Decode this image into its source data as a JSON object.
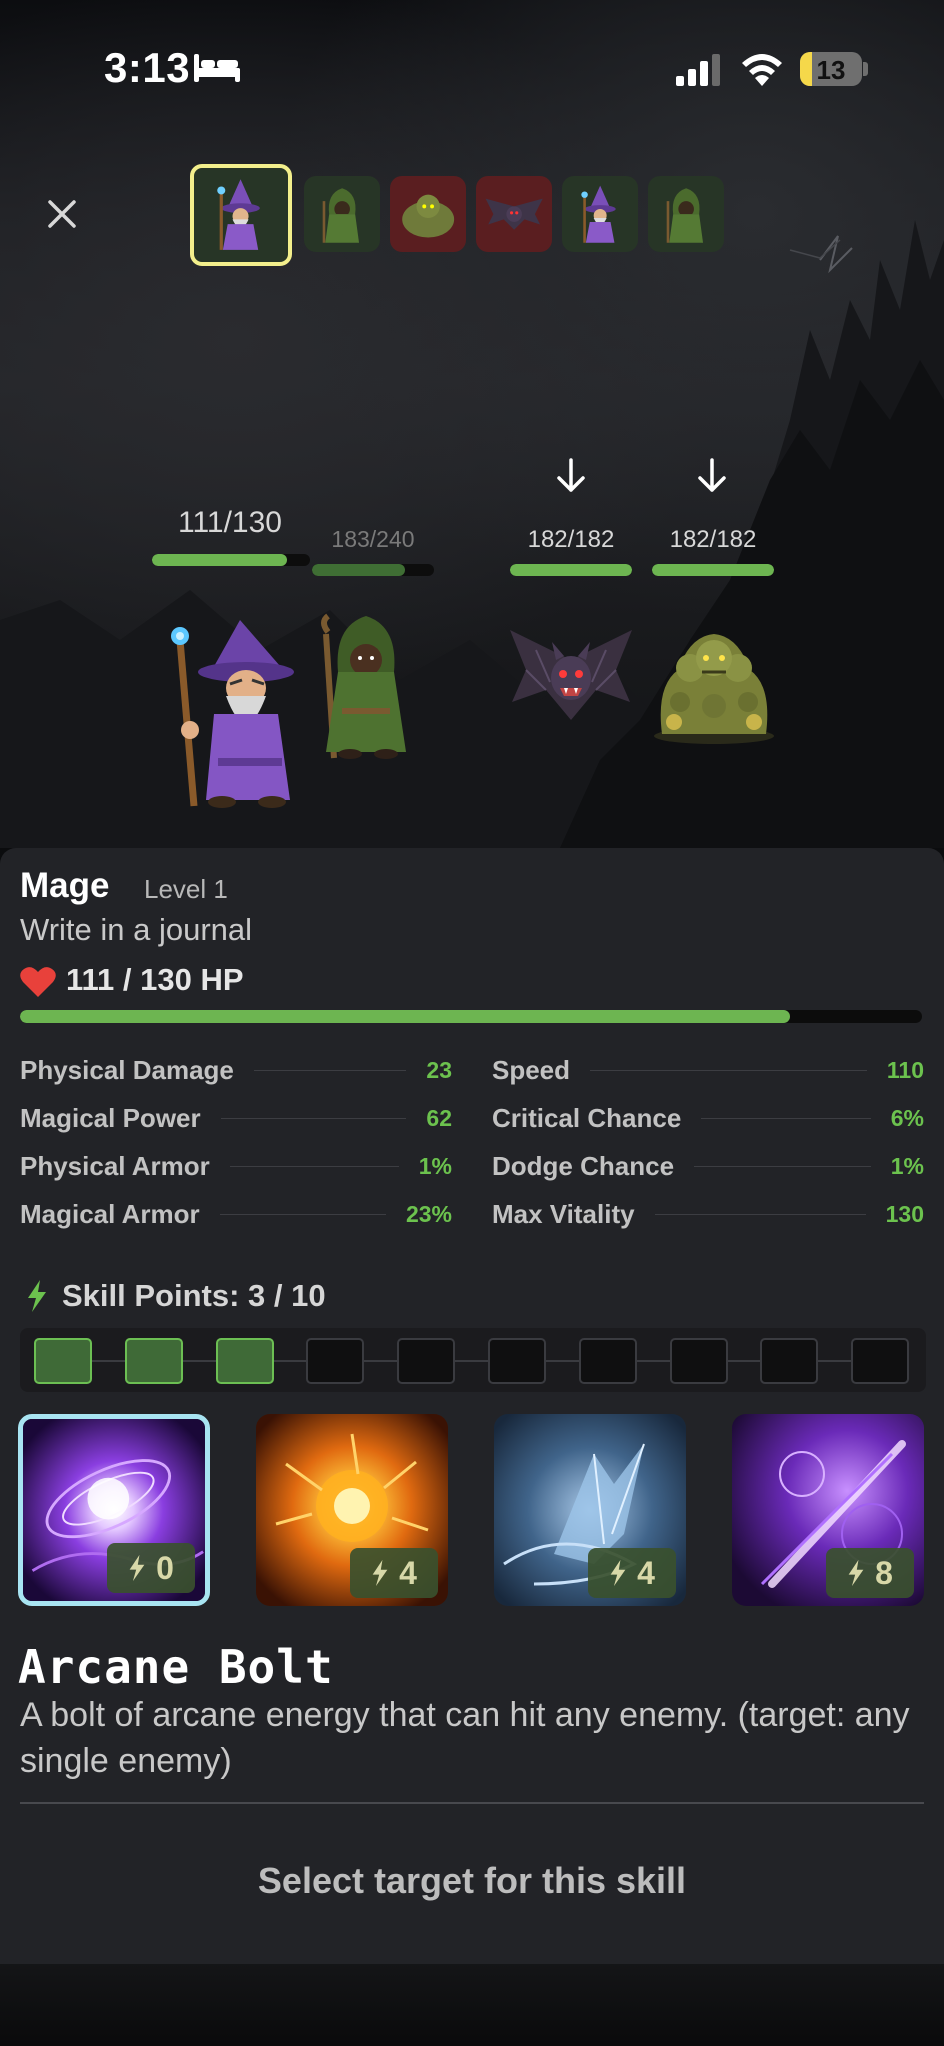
{
  "status_bar": {
    "time": "3:13",
    "battery": "13",
    "icons": [
      "bed-icon",
      "signal-icon",
      "wifi-icon",
      "battery-icon"
    ]
  },
  "turn_order": [
    {
      "unit": "mage",
      "side": "ally",
      "active": true
    },
    {
      "unit": "hooded-rogue",
      "side": "ally",
      "active": false
    },
    {
      "unit": "moss-golem",
      "side": "enemy",
      "active": false
    },
    {
      "unit": "bat",
      "side": "enemy",
      "active": false
    },
    {
      "unit": "mage",
      "side": "ally",
      "active": false
    },
    {
      "unit": "hooded-rogue",
      "side": "ally",
      "active": false
    }
  ],
  "battle": {
    "mage_hp": "111/130",
    "mage_hp_fraction": 0.854,
    "rogue_hp": "183/240",
    "rogue_hp_fraction": 0.7625,
    "bat_hp": "182/182",
    "bat_hp_fraction": 1.0,
    "golem_hp": "182/182",
    "golem_hp_fraction": 1.0
  },
  "character": {
    "name": "Mage",
    "level": "Level 1",
    "task": "Write in a journal",
    "hp_text": "111 / 130 HP",
    "hp_fraction": 0.854
  },
  "stats": {
    "left": [
      {
        "name": "Physical Damage",
        "value": "23"
      },
      {
        "name": "Magical Power",
        "value": "62"
      },
      {
        "name": "Physical Armor",
        "value": "1%"
      },
      {
        "name": "Magical Armor",
        "value": "23%"
      }
    ],
    "right": [
      {
        "name": "Speed",
        "value": "110"
      },
      {
        "name": "Critical Chance",
        "value": "6%"
      },
      {
        "name": "Dodge Chance",
        "value": "1%"
      },
      {
        "name": "Max Vitality",
        "value": "130"
      }
    ]
  },
  "skill_points": {
    "label": "Skill Points: 3 / 10",
    "filled": 3,
    "total": 10
  },
  "skills": [
    {
      "name": "Arcane Bolt",
      "cost": "0",
      "selected": true
    },
    {
      "name": "Fire Burst",
      "cost": "4",
      "selected": false
    },
    {
      "name": "Ice Shard",
      "cost": "4",
      "selected": false
    },
    {
      "name": "Void Comet",
      "cost": "8",
      "selected": false
    }
  ],
  "selected_skill": {
    "title": "Arcane Bolt",
    "description": "A bolt of arcane energy that can hit any enemy. (target: any single enemy)"
  },
  "prompt": "Select target for this skill",
  "colors": {
    "hp_green": "#6db551",
    "stat_value_green": "#6cc24e",
    "active_turn_border": "#f3ef8c",
    "selected_skill_border": "#a8e4f2",
    "enemy_slot": "#5a1e20",
    "ally_slot": "#273526"
  }
}
